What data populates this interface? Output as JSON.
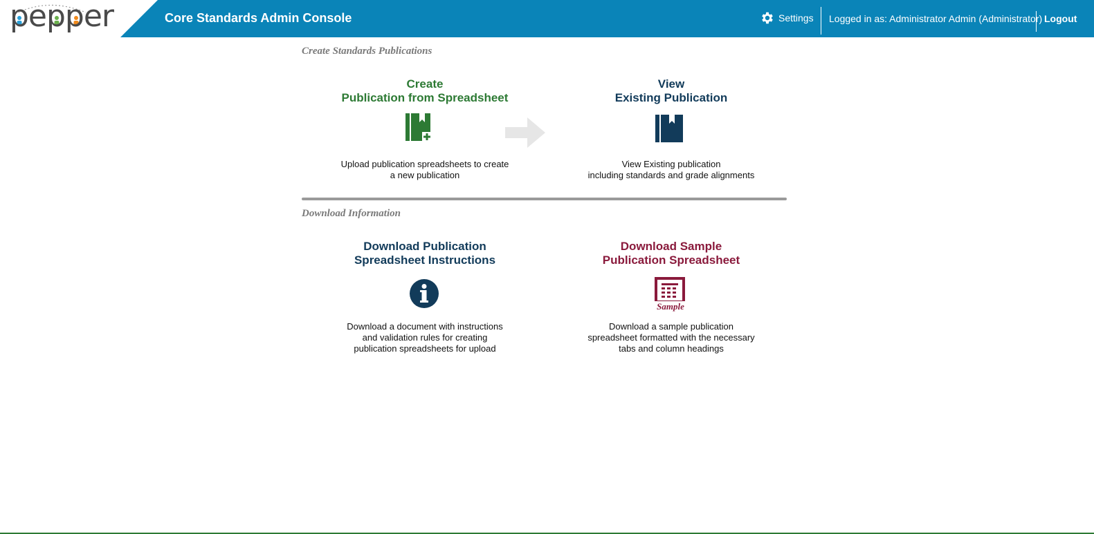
{
  "header": {
    "logo_text": "pepper",
    "title": "Core Standards Admin Console",
    "settings_label": "Settings",
    "logged_in": "Logged in as: Administrator Admin (Administrator)",
    "logout_label": "Logout",
    "bg_color": "#0a84b8"
  },
  "create_section": {
    "title": "Create Standards Publications",
    "cards": [
      {
        "title_line1": "Create",
        "title_line2": "Publication from Spreadsheet",
        "icon": "book-add-icon",
        "desc_line1": "Upload publication spreadsheets to create",
        "desc_line2": "a new publication",
        "color": "#2d7a34"
      },
      {
        "title_line1": "View",
        "title_line2": "Existing Publication",
        "icon": "book-icon",
        "desc_line1": "View Existing publication",
        "desc_line2": "including standards and grade alignments",
        "color": "#123b5a"
      }
    ]
  },
  "download_section": {
    "title": "Download Information",
    "cards": [
      {
        "title_line1": "Download Publication",
        "title_line2": "Spreadsheet Instructions",
        "icon": "info-icon",
        "desc_line1": "Download a document with instructions",
        "desc_line2": "and validation rules for creating",
        "desc_line3": "publication spreadsheets for upload",
        "color": "#123b5a"
      },
      {
        "title_line1": "Download Sample",
        "title_line2": "Publication Spreadsheet",
        "icon": "sample-spreadsheet-icon",
        "icon_label": "Sample",
        "desc_line1": "Download a sample publication",
        "desc_line2": "spreadsheet formatted with the necessary",
        "desc_line3": "tabs and column headings",
        "color": "#8a1a3c"
      }
    ]
  }
}
